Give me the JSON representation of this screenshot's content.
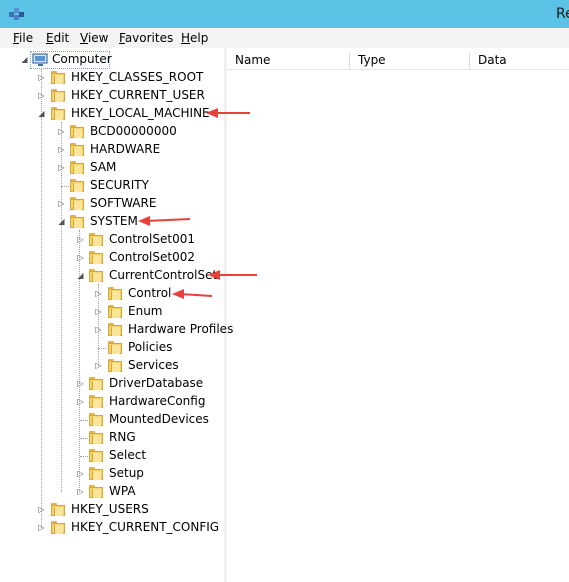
{
  "window": {
    "title": "Re"
  },
  "menu": [
    "File",
    "Edit",
    "View",
    "Favorites",
    "Help"
  ],
  "tree": [
    {
      "label": "Computer",
      "exp": "◢"
    },
    {
      "label": "HKEY_CLASSES_ROOT",
      "exp": "▷"
    },
    {
      "label": "HKEY_CURRENT_USER",
      "exp": "▷"
    },
    {
      "label": "HKEY_LOCAL_MACHINE",
      "exp": "◢"
    },
    {
      "label": "BCD00000000",
      "exp": "▷"
    },
    {
      "label": "HARDWARE",
      "exp": "▷"
    },
    {
      "label": "SAM",
      "exp": "▷"
    },
    {
      "label": "SECURITY",
      "exp": ""
    },
    {
      "label": "SOFTWARE",
      "exp": "▷"
    },
    {
      "label": "SYSTEM",
      "exp": "◢"
    },
    {
      "label": "ControlSet001",
      "exp": "▷"
    },
    {
      "label": "ControlSet002",
      "exp": "▷"
    },
    {
      "label": "CurrentControlSet",
      "exp": "◢"
    },
    {
      "label": "Control",
      "exp": "▷"
    },
    {
      "label": "Enum",
      "exp": "▷"
    },
    {
      "label": "Hardware Profiles",
      "exp": "▷"
    },
    {
      "label": "Policies",
      "exp": ""
    },
    {
      "label": "Services",
      "exp": "▷"
    },
    {
      "label": "DriverDatabase",
      "exp": "▷"
    },
    {
      "label": "HardwareConfig",
      "exp": "▷"
    },
    {
      "label": "MountedDevices",
      "exp": ""
    },
    {
      "label": "RNG",
      "exp": ""
    },
    {
      "label": "Select",
      "exp": ""
    },
    {
      "label": "Setup",
      "exp": "▷"
    },
    {
      "label": "WPA",
      "exp": "▷"
    },
    {
      "label": "HKEY_USERS",
      "exp": "▷"
    },
    {
      "label": "HKEY_CURRENT_CONFIG",
      "exp": "▷"
    }
  ],
  "columns": [
    "Name",
    "Type",
    "Data"
  ],
  "accent": {
    "titlebar": "#5bc3e6",
    "arrow": "#e8413b",
    "folder": "#f5d46b"
  }
}
